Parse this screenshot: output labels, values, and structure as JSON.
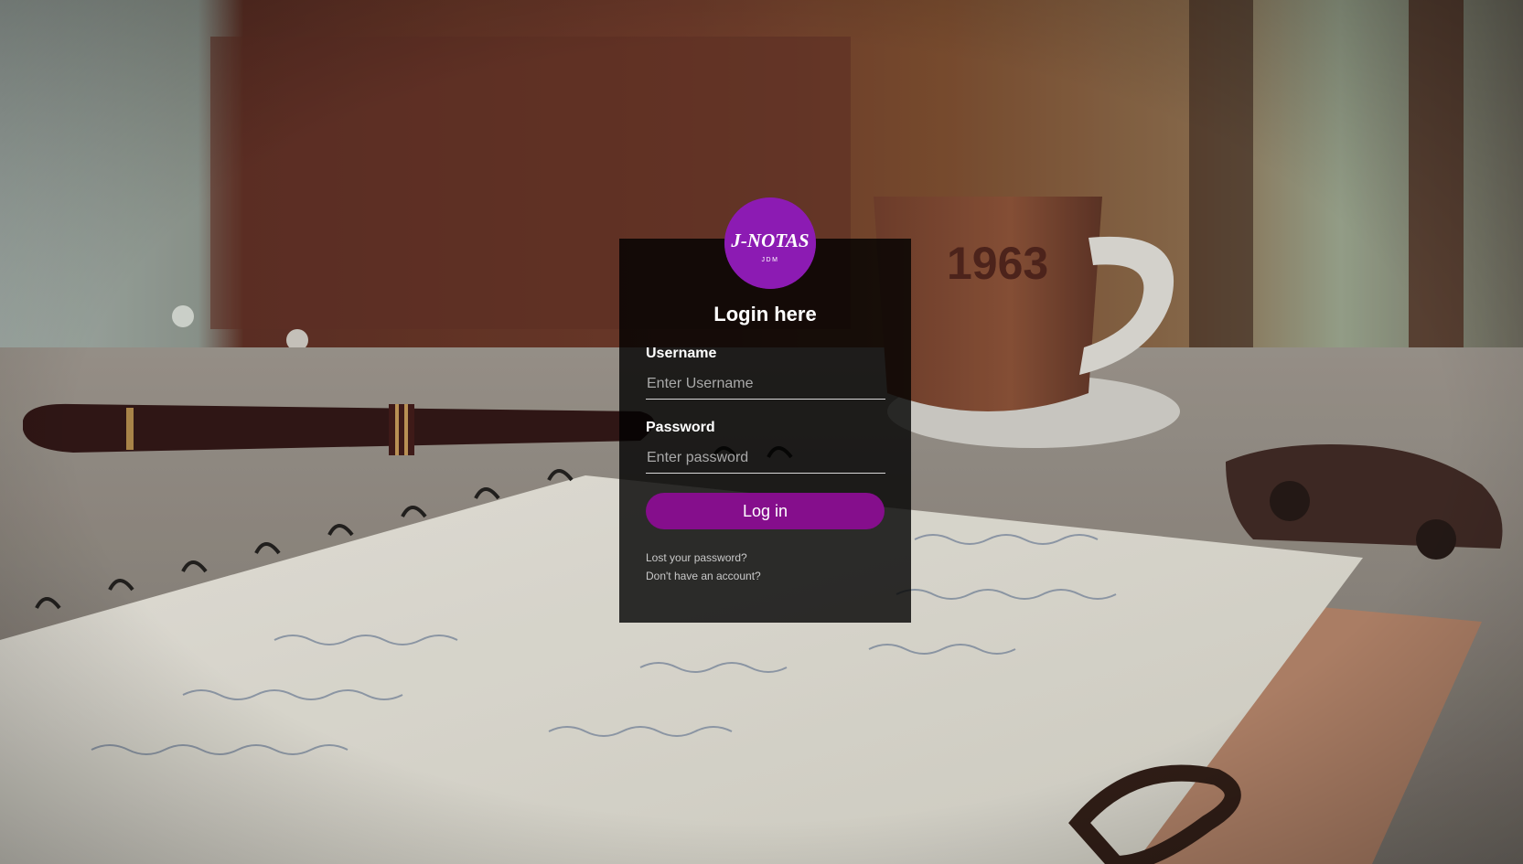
{
  "logo": {
    "text": "J-NOTAS",
    "subtext": "JDM",
    "color": "#8c1bb3"
  },
  "login": {
    "title": "Login here",
    "username_label": "Username",
    "username_placeholder": "Enter Username",
    "password_label": "Password",
    "password_placeholder": "Enter password",
    "submit_label": "Log in",
    "lost_password_link": "Lost your password?",
    "signup_link": "Don't have an account?",
    "button_color": "#850e8c"
  }
}
